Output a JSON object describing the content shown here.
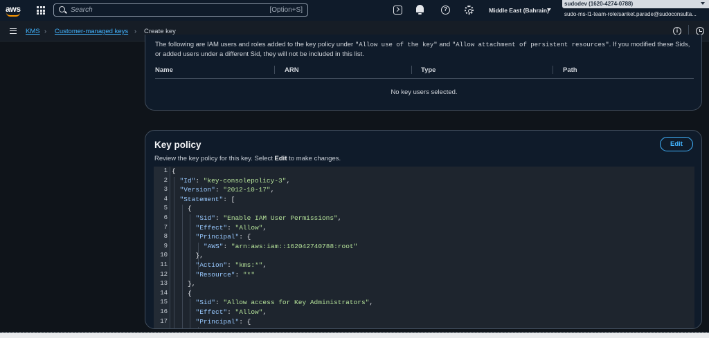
{
  "topnav": {
    "logo": "aws",
    "search_placeholder": "Search",
    "search_shortcut": "[Option+S]",
    "region": "Middle East (Bahrain)",
    "account": "sudodev (1620-4274-0788)",
    "role": "sudo-ms-l1-team-role/sanket.parade@sudoconsulta...",
    "icons": [
      "apps-grid-icon",
      "search-icon",
      "cloudshell-icon",
      "bell-icon",
      "help-icon",
      "gear-icon"
    ]
  },
  "breadcrumb": {
    "items": [
      "KMS",
      "Customer-managed keys",
      "Create key"
    ]
  },
  "key_users": {
    "intro_before": "The following are IAM users and roles added to the key policy under ",
    "intro_code1": "\"Allow use of the key\"",
    "intro_mid": " and ",
    "intro_code2": "\"Allow attachment of persistent resources\"",
    "intro_after": ". If you modified these Sids, or added users under a different Sid, they will not be included in this list.",
    "columns": [
      "Name",
      "ARN",
      "Type",
      "Path"
    ],
    "empty_text": "No key users selected."
  },
  "key_policy": {
    "title": "Key policy",
    "desc_before": "Review the key policy for this key. Select ",
    "desc_bold": "Edit",
    "desc_after": " to make changes.",
    "edit_label": "Edit",
    "lines": [
      {
        "n": "1",
        "indent": 0,
        "parts": [
          {
            "t": "{",
            "c": "p"
          }
        ]
      },
      {
        "n": "2",
        "indent": 1,
        "parts": [
          {
            "t": "\"Id\"",
            "c": "k"
          },
          {
            "t": ": ",
            "c": "p"
          },
          {
            "t": "\"key-consolepolicy-3\"",
            "c": "s"
          },
          {
            "t": ",",
            "c": "p"
          }
        ]
      },
      {
        "n": "3",
        "indent": 1,
        "parts": [
          {
            "t": "\"Version\"",
            "c": "k"
          },
          {
            "t": ": ",
            "c": "p"
          },
          {
            "t": "\"2012-10-17\"",
            "c": "s"
          },
          {
            "t": ",",
            "c": "p"
          }
        ]
      },
      {
        "n": "4",
        "indent": 1,
        "parts": [
          {
            "t": "\"Statement\"",
            "c": "k"
          },
          {
            "t": ": [",
            "c": "p"
          }
        ]
      },
      {
        "n": "5",
        "indent": 2,
        "parts": [
          {
            "t": "{",
            "c": "p"
          }
        ]
      },
      {
        "n": "6",
        "indent": 3,
        "parts": [
          {
            "t": "\"Sid\"",
            "c": "k"
          },
          {
            "t": ": ",
            "c": "p"
          },
          {
            "t": "\"Enable IAM User Permissions\"",
            "c": "s"
          },
          {
            "t": ",",
            "c": "p"
          }
        ]
      },
      {
        "n": "7",
        "indent": 3,
        "parts": [
          {
            "t": "\"Effect\"",
            "c": "k"
          },
          {
            "t": ": ",
            "c": "p"
          },
          {
            "t": "\"Allow\"",
            "c": "s"
          },
          {
            "t": ",",
            "c": "p"
          }
        ]
      },
      {
        "n": "8",
        "indent": 3,
        "parts": [
          {
            "t": "\"Principal\"",
            "c": "k"
          },
          {
            "t": ": {",
            "c": "p"
          }
        ]
      },
      {
        "n": "9",
        "indent": 4,
        "parts": [
          {
            "t": "\"AWS\"",
            "c": "k"
          },
          {
            "t": ": ",
            "c": "p"
          },
          {
            "t": "\"arn:aws:iam::162042740788:root\"",
            "c": "s"
          }
        ]
      },
      {
        "n": "10",
        "indent": 3,
        "parts": [
          {
            "t": "},",
            "c": "p"
          }
        ]
      },
      {
        "n": "11",
        "indent": 3,
        "parts": [
          {
            "t": "\"Action\"",
            "c": "k"
          },
          {
            "t": ": ",
            "c": "p"
          },
          {
            "t": "\"kms:*\"",
            "c": "s"
          },
          {
            "t": ",",
            "c": "p"
          }
        ]
      },
      {
        "n": "12",
        "indent": 3,
        "parts": [
          {
            "t": "\"Resource\"",
            "c": "k"
          },
          {
            "t": ": ",
            "c": "p"
          },
          {
            "t": "\"*\"",
            "c": "s"
          }
        ]
      },
      {
        "n": "13",
        "indent": 2,
        "parts": [
          {
            "t": "},",
            "c": "p"
          }
        ]
      },
      {
        "n": "14",
        "indent": 2,
        "parts": [
          {
            "t": "{",
            "c": "p"
          }
        ]
      },
      {
        "n": "15",
        "indent": 3,
        "parts": [
          {
            "t": "\"Sid\"",
            "c": "k"
          },
          {
            "t": ": ",
            "c": "p"
          },
          {
            "t": "\"Allow access for Key Administrators\"",
            "c": "s"
          },
          {
            "t": ",",
            "c": "p"
          }
        ]
      },
      {
        "n": "16",
        "indent": 3,
        "parts": [
          {
            "t": "\"Effect\"",
            "c": "k"
          },
          {
            "t": ": ",
            "c": "p"
          },
          {
            "t": "\"Allow\"",
            "c": "s"
          },
          {
            "t": ",",
            "c": "p"
          }
        ]
      },
      {
        "n": "17",
        "indent": 3,
        "parts": [
          {
            "t": "\"Principal\"",
            "c": "k"
          },
          {
            "t": ": {",
            "c": "p"
          }
        ]
      }
    ]
  },
  "colors": {
    "link": "#42b4ff",
    "json_key": "#99c9ff",
    "json_string": "#b6e39a",
    "aws_orange": "#ff9900"
  }
}
